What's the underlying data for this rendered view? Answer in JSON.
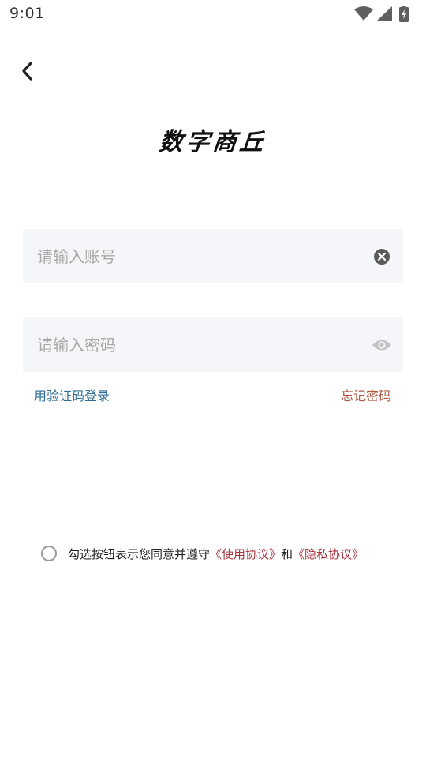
{
  "status_bar": {
    "time": "9:01"
  },
  "header": {
    "title": "数字商丘"
  },
  "login": {
    "account_placeholder": "请输入账号",
    "password_placeholder": "请输入密码",
    "sms_login_label": "用验证码登录",
    "forgot_password_label": "忘记密码"
  },
  "agreement": {
    "prefix": "勾选按钮表示您同意并遵守",
    "terms_label": "《使用协议》",
    "connector": "和",
    "privacy_label": "《隐私协议》"
  },
  "icons": {
    "back": "chevron-left-icon",
    "clear": "clear-circle-icon",
    "password_visibility": "eye-icon",
    "wifi": "wifi-icon",
    "signal": "signal-icon",
    "battery": "battery-charging-icon"
  },
  "colors": {
    "background": "#ffffff",
    "field_background": "#f5f6fa",
    "sms_link": "#2f6c96",
    "forgot_link": "#b0573f",
    "agreement_link": "#a8333d",
    "placeholder": "#a8a8a8"
  }
}
